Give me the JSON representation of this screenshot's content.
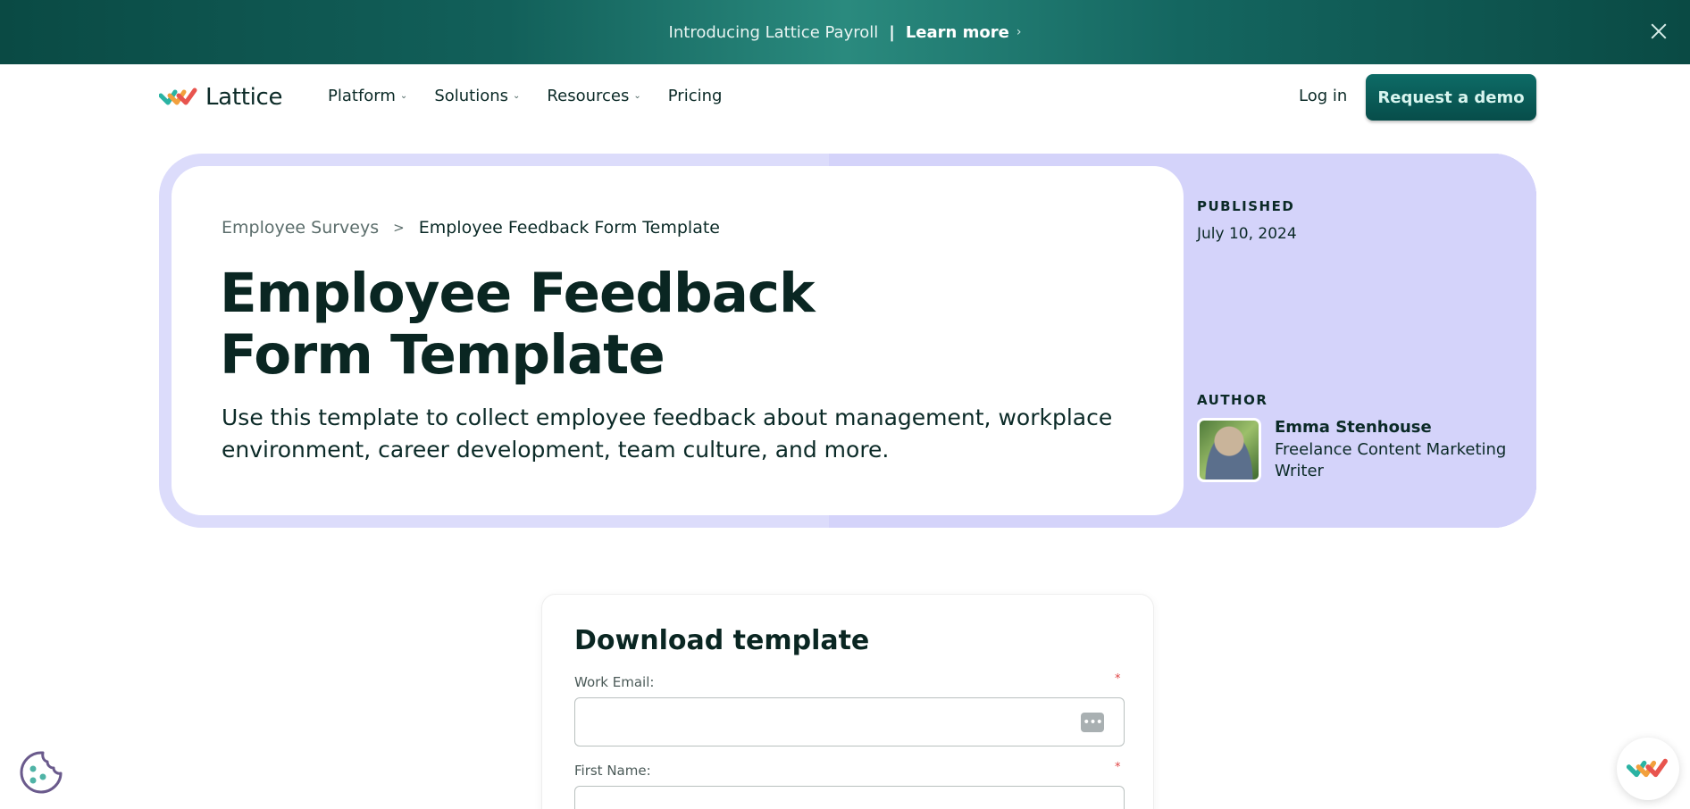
{
  "banner": {
    "text": "Introducing Lattice Payroll",
    "separator": "|",
    "link": "Learn more",
    "chevron": "›"
  },
  "nav": {
    "logo_text": "Lattice",
    "menu": [
      {
        "label": "Platform",
        "has_dropdown": true
      },
      {
        "label": "Solutions",
        "has_dropdown": true
      },
      {
        "label": "Resources",
        "has_dropdown": true
      },
      {
        "label": "Pricing",
        "has_dropdown": false
      }
    ],
    "caret": "⌄",
    "login": "Log in",
    "cta": "Request a demo"
  },
  "hero": {
    "breadcrumb": {
      "parent": "Employee Surveys",
      "separator": ">",
      "current": "Employee Feedback Form Template"
    },
    "title": "Employee Feedback Form Template",
    "description": "Use this template to collect employee feedback about management, workplace environment, career development, team culture, and more.",
    "published_label": "PUBLISHED",
    "published_date": "July 10, 2024",
    "author_label": "AUTHOR",
    "author_name": "Emma Stenhouse",
    "author_role": "Freelance Content Marketing Writer"
  },
  "form": {
    "title": "Download template",
    "fields": [
      {
        "label": "Work Email:",
        "required_mark": "*",
        "value": ""
      },
      {
        "label": "First Name:",
        "required_mark": "*",
        "value": ""
      }
    ],
    "autofill_icon": "•••"
  },
  "colors": {
    "brand_dark": "#074d4a",
    "hero_bg": "#dcdcfb",
    "required": "#e04545"
  },
  "icons": [
    "close-icon",
    "lattice-logo-icon",
    "chevron-down-icon",
    "password-manager-icon",
    "cookie-icon",
    "lattice-chat-icon"
  ]
}
